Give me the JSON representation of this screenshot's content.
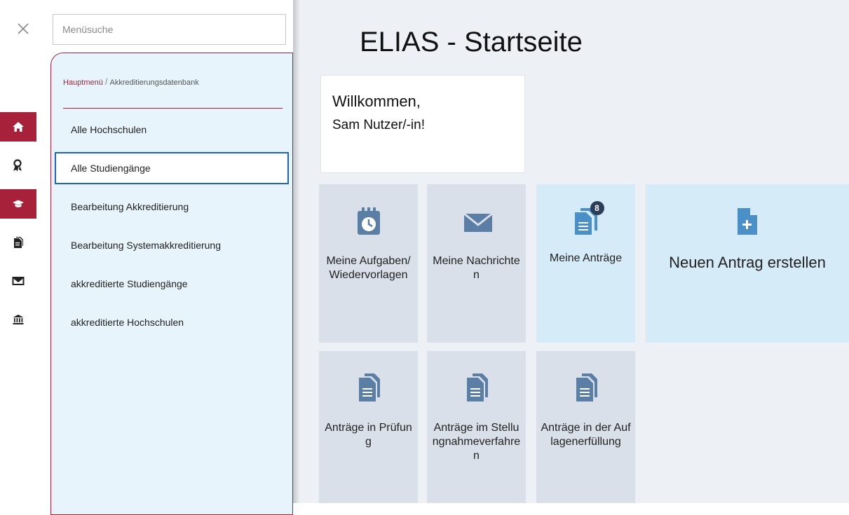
{
  "app": {
    "close_icon": "close-icon"
  },
  "rail": {
    "items": [
      {
        "icon": "home-icon",
        "active": true
      },
      {
        "icon": "award-icon",
        "active": false
      },
      {
        "icon": "graduation-cap-icon",
        "active": true
      },
      {
        "icon": "document-icon",
        "active": false
      },
      {
        "icon": "envelope-icon",
        "active": false
      },
      {
        "icon": "institution-icon",
        "active": false
      }
    ]
  },
  "menu": {
    "search_placeholder": "Menüsuche",
    "breadcrumb": {
      "home": "Hauptmenü",
      "separator": "/",
      "current": "Akkreditierungsdatenbank"
    },
    "items": [
      {
        "label": "Alle Hochschulen"
      },
      {
        "label": "Alle Studiengänge",
        "selected": true
      },
      {
        "label": "Bearbeitung Akkreditierung"
      },
      {
        "label": "Bearbeitung Systemakkreditierung"
      },
      {
        "label": "akkreditierte Studiengänge"
      },
      {
        "label": "akkreditierte Hochschulen"
      }
    ]
  },
  "main": {
    "title": "ELIAS - Startseite",
    "welcome": {
      "line1": "Willkommen,",
      "line2": "Sam Nutzer/-in!"
    },
    "tiles": [
      {
        "label": "Meine Aufgaben/ Wiedervorlagen",
        "icon": "calendar-clock-icon"
      },
      {
        "label": "Meine Nachrichten",
        "icon": "envelope-icon"
      },
      {
        "label": "Meine Anträge",
        "icon": "documents-icon",
        "badge": "8"
      },
      {
        "label": "Neuen Antrag erstellen",
        "icon": "new-document-icon"
      },
      {
        "label": "Anträge in Prüfung",
        "icon": "document-icon"
      },
      {
        "label": "Anträge im Stellungnahmeverfahren",
        "icon": "document-icon"
      },
      {
        "label": "Anträge in der Auflagenerfüllung",
        "icon": "document-icon"
      }
    ]
  },
  "colors": {
    "brand": "#a8213a",
    "selected_border": "#1e64c8",
    "tile": "#d9e0e9",
    "tile_light": "#d5ebf7",
    "icon": "#5b7fa4"
  }
}
